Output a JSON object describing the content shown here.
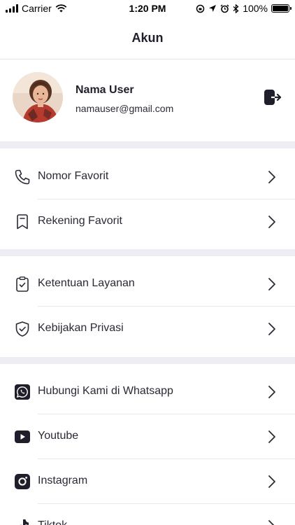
{
  "status_bar": {
    "carrier": "Carrier",
    "time": "1:20 PM",
    "battery": "100%"
  },
  "header": {
    "title": "Akun"
  },
  "profile": {
    "name": "Nama User",
    "email": "namauser@gmail.com",
    "logout_icon": "logout-icon"
  },
  "menu": {
    "favorites": [
      {
        "label": "Nomor Favorit",
        "icon": "phone-icon"
      },
      {
        "label": "Rekening Favorit",
        "icon": "bookmark-icon"
      }
    ],
    "legal": [
      {
        "label": "Ketentuan Layanan",
        "icon": "clipboard-check-icon"
      },
      {
        "label": "Kebijakan Privasi",
        "icon": "shield-check-icon"
      }
    ],
    "social": [
      {
        "label": "Hubungi Kami di Whatsapp",
        "icon": "whatsapp-icon"
      },
      {
        "label": "Youtube",
        "icon": "youtube-icon"
      },
      {
        "label": "Instagram",
        "icon": "instagram-icon"
      },
      {
        "label": "Tiktok",
        "icon": "tiktok-icon"
      }
    ]
  },
  "colors": {
    "section_gap": "#ededf3",
    "divider": "#e8e8ee",
    "text": "#1f1f2b"
  }
}
